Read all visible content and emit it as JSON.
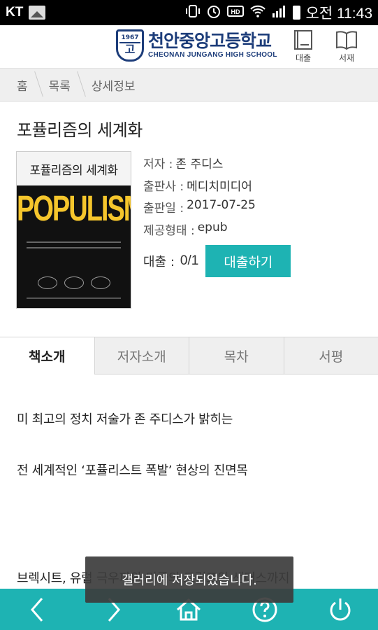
{
  "status_bar": {
    "carrier": "KT",
    "time": "오전 11:43",
    "icons": [
      "vibrate-icon",
      "alarm-icon",
      "hd-icon",
      "wifi-icon",
      "signal-icon",
      "battery-icon"
    ]
  },
  "header": {
    "school_name_ko": "천안중앙고등학교",
    "school_name_en": "CHEONAN JUNGANG HIGH SCHOOL",
    "emblem_top": "1967",
    "emblem_bottom": "고",
    "loan_label": "대출",
    "shelf_label": "서재"
  },
  "breadcrumb": [
    "홈",
    "목록",
    "상세정보"
  ],
  "book": {
    "title": "포퓰리즘의 세계화",
    "cover_title": "포퓰리즘의 세계화",
    "cover_word": "POPULISM",
    "author_label": "저자 :",
    "author": "존 주디스",
    "publisher_label": "출판사 :",
    "publisher": "메디치미디어",
    "pubdate_label": "출판일 :",
    "pubdate": "2017-07-25",
    "format_label": "제공형태 :",
    "format": "epub",
    "loan_label": "대출 :",
    "loan_count": "0/1",
    "loan_button": "대출하기"
  },
  "tabs": [
    "책소개",
    "저자소개",
    "목차",
    "서평"
  ],
  "intro_lines": [
    "미 최고의 정치 저술가 존 주디스가 밝히는",
    "전 세계적인 ‘포퓰리스트 폭발’ 현상의 진면목",
    "브렉시트, 유럽 극우파와 미국의 트럼프와 샌더스까지"
  ],
  "toast": "갤러리에 저장되었습니다.",
  "bottom_nav": [
    "back-icon",
    "forward-icon",
    "home-icon",
    "help-icon",
    "power-icon"
  ],
  "colors": {
    "accent": "#1eb3b3",
    "school_blue": "#1d3d7a",
    "cover_yellow": "#f6c62c"
  }
}
